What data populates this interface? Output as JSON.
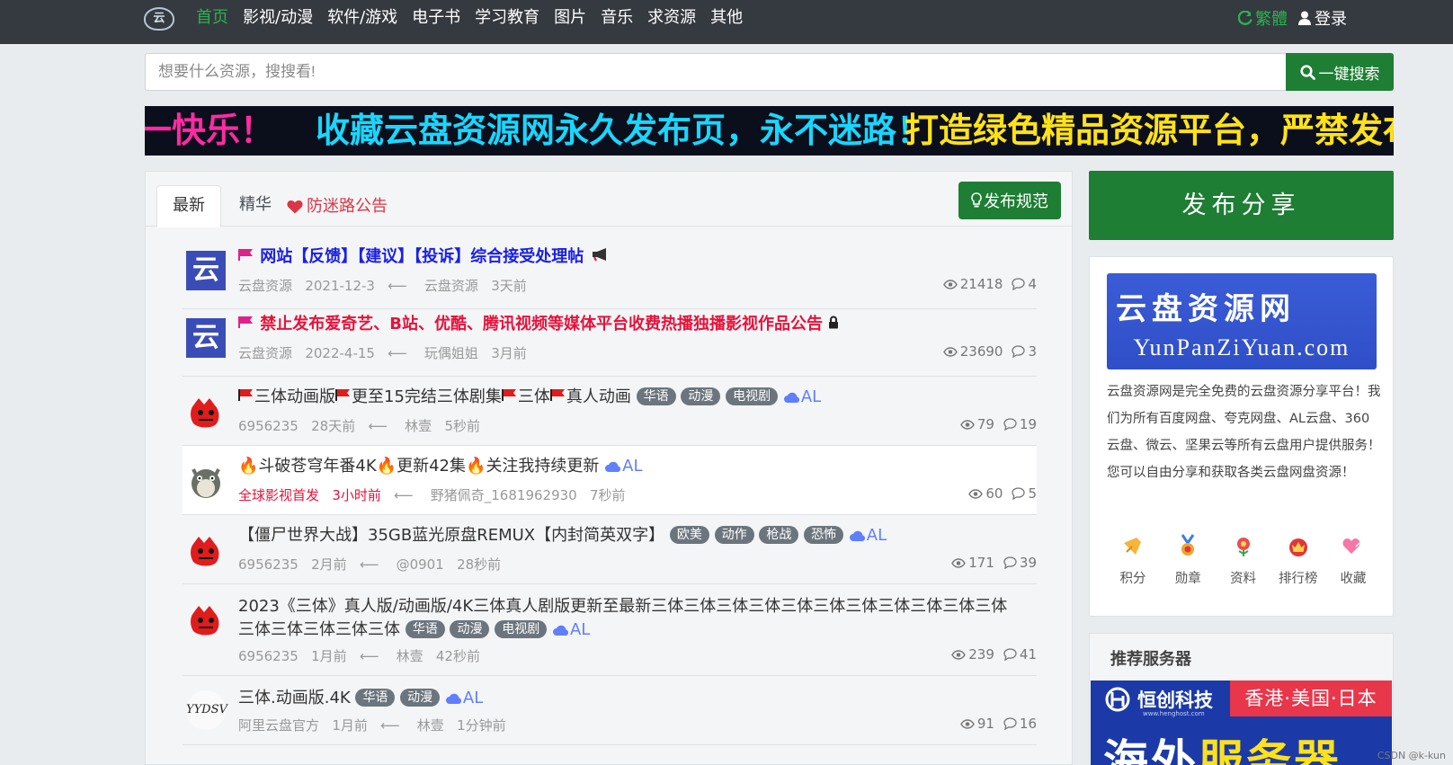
{
  "nav": {
    "logo_text": "云",
    "links": [
      "首页",
      "影视/动漫",
      "软件/游戏",
      "电子书",
      "学习教育",
      "图片",
      "音乐",
      "求资源",
      "其他"
    ],
    "traditional": "繁體",
    "login": "登录"
  },
  "search": {
    "placeholder": "想要什么资源，搜搜看!",
    "button": "一键搜索"
  },
  "marquee": {
    "part1": "一快乐！",
    "part2": "收藏云盘资源网永久发布页，永不迷路！",
    "part3": "打造绿色精品资源平台，严禁发布色"
  },
  "tabs": {
    "latest": "最新",
    "featured": "精华",
    "notice": "防迷路公告",
    "rules_button": "发布规范"
  },
  "posts": [
    {
      "avatar_text": "云",
      "title": "网站【反馈】【建议】【投诉】综合接受处理帖",
      "author": "云盘资源",
      "date": "2021-12-3",
      "last_user": "云盘资源",
      "last_time": "3天前",
      "views": "21418",
      "replies": "4"
    },
    {
      "avatar_text": "云",
      "title": "禁止发布爱奇艺、B站、优酷、腾讯视频等媒体平台收费热播独播影视作品公告",
      "author": "云盘资源",
      "date": "2022-4-15",
      "last_user": "玩偶姐姐",
      "last_time": "3月前",
      "views": "23690",
      "replies": "3"
    },
    {
      "title": "三体动画版",
      "title_b": "更至15完结三体剧集",
      "title_c": "三体",
      "title_d": "真人动画",
      "tags": [
        "华语",
        "动漫",
        "电视剧"
      ],
      "al": "AL",
      "author": "6956235",
      "date": "28天前",
      "last_user": "林壹",
      "last_time": "5秒前",
      "views": "79",
      "replies": "19"
    },
    {
      "title": "斗破苍穹年番4K",
      "title_b": "更新42集",
      "title_c": "关注我持续更新",
      "al": "AL",
      "author": "全球影视首发",
      "date": "3小时前",
      "last_user": "野猪佩奇_1681962930",
      "last_time": "7秒前",
      "views": "60",
      "replies": "5"
    },
    {
      "title": "【僵尸世界大战】35GB蓝光原盘REMUX【内封简英双字】",
      "tags": [
        "欧美",
        "动作",
        "枪战",
        "恐怖"
      ],
      "al": "AL",
      "author": "6956235",
      "date": "2月前",
      "last_user": "@0901",
      "last_time": "28秒前",
      "views": "171",
      "replies": "39"
    },
    {
      "title": "2023《三体》真人版/动画版/4K三体真人剧版更新至最新三体三体三体三体三体三体三体三体三体三体三体三体三体三体三体三体",
      "tags": [
        "华语",
        "动漫",
        "电视剧"
      ],
      "al": "AL",
      "author": "6956235",
      "date": "1月前",
      "last_user": "林壹",
      "last_time": "42秒前",
      "views": "239",
      "replies": "41"
    },
    {
      "avatar_text": "YYDSV",
      "title": "三体.动画版.4K",
      "tags": [
        "华语",
        "动漫"
      ],
      "al": "AL",
      "author": "阿里云盘官方",
      "date": "1月前",
      "last_user": "林壹",
      "last_time": "1分钟前",
      "views": "91",
      "replies": "16"
    }
  ],
  "sidebar": {
    "publish": "发布分享",
    "banner_cn": "云盘资源网",
    "banner_en": "YunPanZiYuan.com",
    "description": "云盘资源网是完全免费的云盘资源分享平台！我们为所有百度网盘、夸克网盘、AL云盘、360云盘、微云、坚果云等所有云盘用户提供服务！您可以自由分享和获取各类云盘网盘资源！",
    "icons": [
      "积分",
      "勋章",
      "资料",
      "排行榜",
      "收藏"
    ],
    "servers_title": "推荐服务器",
    "ad_brand": "恒创科技",
    "ad_sub": "www.henghost.com",
    "ad_region": "香港·美国·日本",
    "ad_big_a": "海外",
    "ad_big_b": "服务器"
  },
  "watermark": "CSDN @k-kun",
  "colors": {
    "green": "#1e7e34",
    "nav_bg": "#343a40",
    "active_nav": "#28b44b",
    "hot_red": "#e6123a",
    "pin_blue": "#1a20e6"
  }
}
